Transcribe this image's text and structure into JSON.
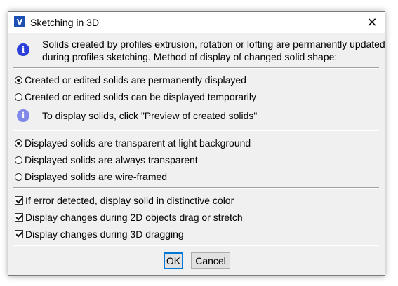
{
  "window": {
    "title": "Sketching in 3D",
    "app_icon_glyph": "V",
    "close_glyph": "✕"
  },
  "intro": {
    "line1": "Solids created by profiles extrusion, rotation or lofting are permanently updated",
    "line2": "during profiles sketching. Method of display of changed solid shape:"
  },
  "display_mode": {
    "options": [
      {
        "label": "Created or edited solids are permanently displayed",
        "selected": true
      },
      {
        "label": "Created or edited solids can be displayed temporarily",
        "selected": false
      }
    ],
    "hint": "To display solids, click \"Preview of created solids\""
  },
  "transparency": {
    "options": [
      {
        "label": "Displayed solids are transparent at light background",
        "selected": true
      },
      {
        "label": "Displayed solids are always transparent",
        "selected": false
      },
      {
        "label": "Displayed solids are wire-framed",
        "selected": false
      }
    ]
  },
  "checks": [
    {
      "label": "If error detected, display solid in distinctive color",
      "checked": true
    },
    {
      "label": "Display changes during 2D objects drag or stretch",
      "checked": true
    },
    {
      "label": "Display changes during 3D dragging",
      "checked": true
    }
  ],
  "buttons": {
    "ok": "OK",
    "cancel": "Cancel"
  },
  "colors": {
    "info_icon": "#2c3fd9",
    "info_icon_light": "#8088e8",
    "default_button_border": "#0078d7"
  },
  "icons": {
    "info": "i"
  }
}
